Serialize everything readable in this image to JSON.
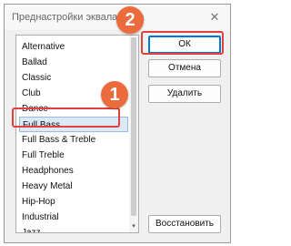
{
  "dialog": {
    "title": "Преднастройки эквалайзера",
    "close_label": "✕"
  },
  "list": {
    "items": [
      {
        "label": "Alternative",
        "selected": false
      },
      {
        "label": "Ballad",
        "selected": false
      },
      {
        "label": "Classic",
        "selected": false
      },
      {
        "label": "Club",
        "selected": false
      },
      {
        "label": "Dance",
        "selected": false
      },
      {
        "label": "Full Bass",
        "selected": true
      },
      {
        "label": "Full Bass & Treble",
        "selected": false
      },
      {
        "label": "Full Treble",
        "selected": false
      },
      {
        "label": "Headphones",
        "selected": false
      },
      {
        "label": "Heavy Metal",
        "selected": false
      },
      {
        "label": "Hip-Hop",
        "selected": false
      },
      {
        "label": "Industrial",
        "selected": false
      },
      {
        "label": "Jazz",
        "selected": false
      }
    ],
    "scroll_down_icon": "▾"
  },
  "buttons": {
    "ok": "ОК",
    "cancel": "Отмена",
    "delete": "Удалить",
    "restore": "Восстановить"
  },
  "annotations": {
    "badge_1": "1",
    "badge_2": "2",
    "color": "#e0413c",
    "badge_color": "#ec6b3c"
  }
}
